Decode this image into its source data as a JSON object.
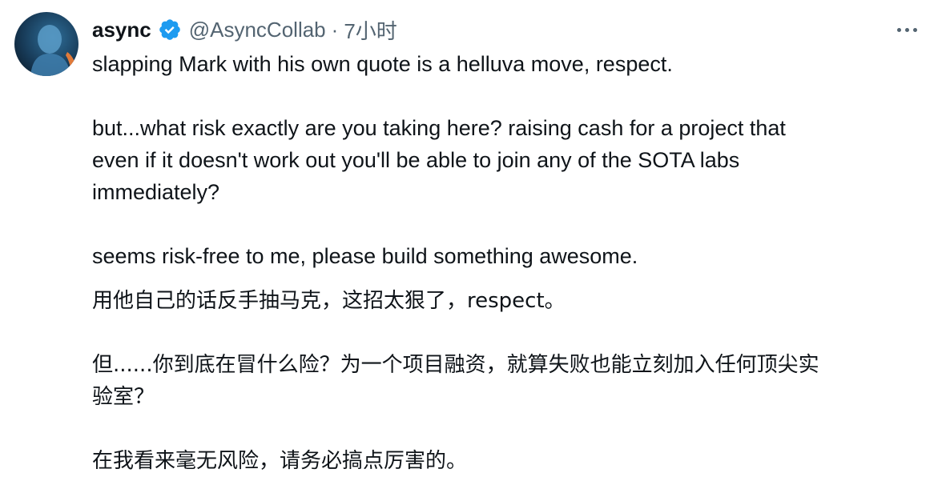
{
  "tweet": {
    "display_name": "async",
    "handle": "@AsyncCollab",
    "separator": "·",
    "time": "7小时",
    "icons": {
      "verified": "verified-badge-icon",
      "more": "more-options-icon"
    },
    "colors": {
      "text": "#0f1419",
      "secondary": "#536471",
      "verified": "#1d9bf0"
    },
    "body_en": [
      "slapping Mark with his own quote is a helluva move, respect.",
      "but...what risk exactly are you taking here? raising cash for a project that",
      "even if it doesn't work out you'll be able to join any of the SOTA labs",
      "immediately?",
      "seems risk-free to me, please build something awesome."
    ],
    "body_zh": [
      "用他自己的话反手抽马克，这招太狠了，respect。",
      "但......你到底在冒什么险？为一个项目融资，就算失败也能立刻加入任何顶尖实",
      "验室？",
      "在我看来毫无风险，请务必搞点厉害的。"
    ]
  }
}
